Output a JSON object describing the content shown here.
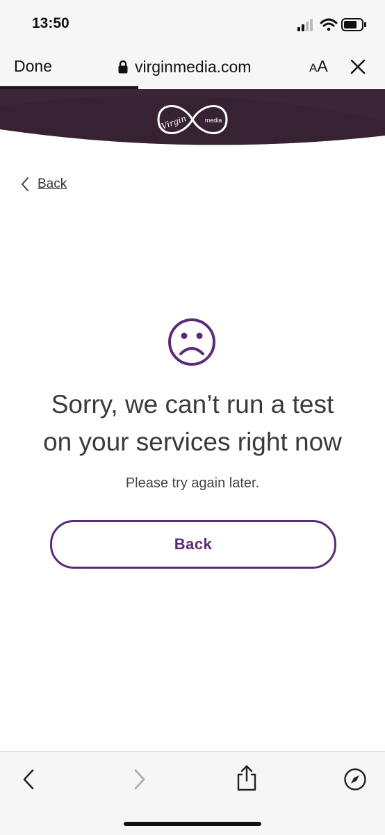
{
  "status_bar": {
    "time": "13:50"
  },
  "browser": {
    "done_label": "Done",
    "url": "virginmedia.com",
    "aa_small": "A",
    "aa_big": "A",
    "load_progress": 0.36
  },
  "brand": {
    "logo_word_1": "Virgin",
    "logo_word_2": "media",
    "primary_color": "#5c2a74",
    "header_color": "#3b2637"
  },
  "nav": {
    "back_link_label": "Back"
  },
  "error": {
    "headline_line1": "Sorry, we can’t run a test",
    "headline_line2": "on your services right now",
    "subtext": "Please try again later.",
    "back_button_label": "Back"
  },
  "icons": {
    "lock": "lock-icon",
    "close": "close-icon",
    "sad_face": "sad-face-icon",
    "back_chevron": "chevron-left-icon",
    "toolbar": [
      "chevron-left-icon",
      "chevron-right-icon",
      "share-icon",
      "compass-icon"
    ]
  }
}
